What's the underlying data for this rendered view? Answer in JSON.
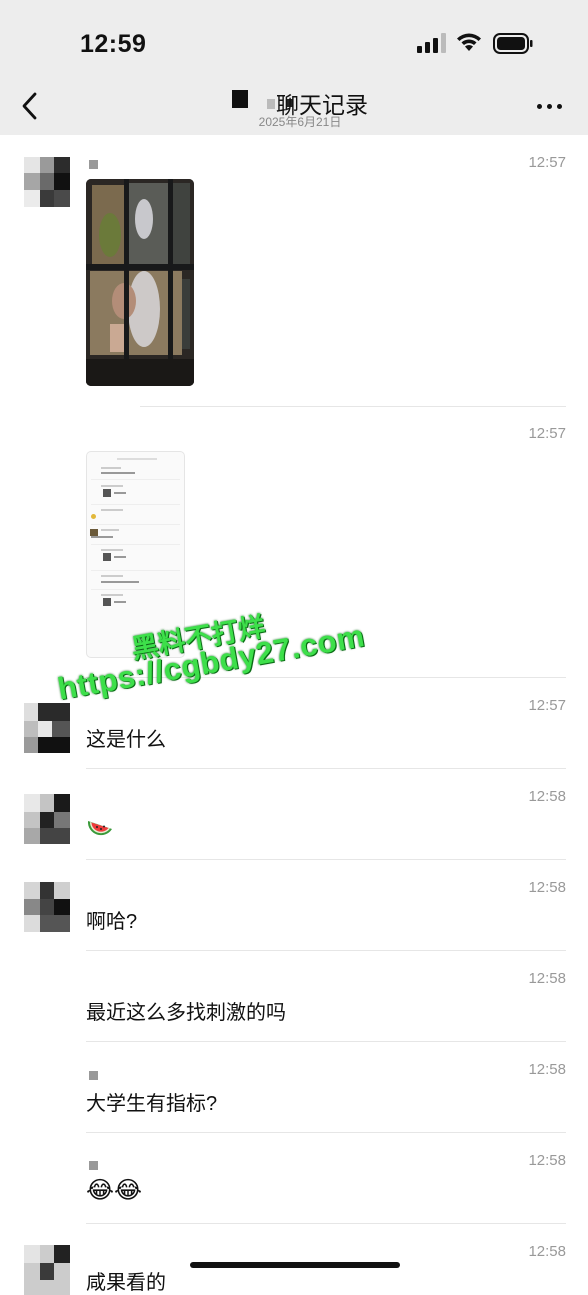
{
  "status": {
    "time": "12:59"
  },
  "header": {
    "title": "聊天记录",
    "subtitle": "2025年6月21日"
  },
  "messages": [
    {
      "time": "12:57",
      "kind": "image"
    },
    {
      "time": "12:57",
      "kind": "screenshot"
    },
    {
      "time": "12:57",
      "text": "这是什么"
    },
    {
      "time": "12:58",
      "emoji": "watermelon"
    },
    {
      "time": "12:58",
      "text": "啊哈?"
    },
    {
      "time": "12:58",
      "text": "最近这么多找刺激的吗"
    },
    {
      "time": "12:58",
      "text": "大学生有指标?"
    },
    {
      "time": "12:58",
      "text": "😂😂"
    },
    {
      "time": "12:58",
      "text": "咸果看的"
    }
  ],
  "watermark": {
    "line1": "黑料不打烊",
    "line2": "https://cgbdy27.com"
  },
  "colors": {
    "header_bg": "#ededed",
    "watermark_green": "#3ddf4a",
    "time_gray": "#999999"
  }
}
